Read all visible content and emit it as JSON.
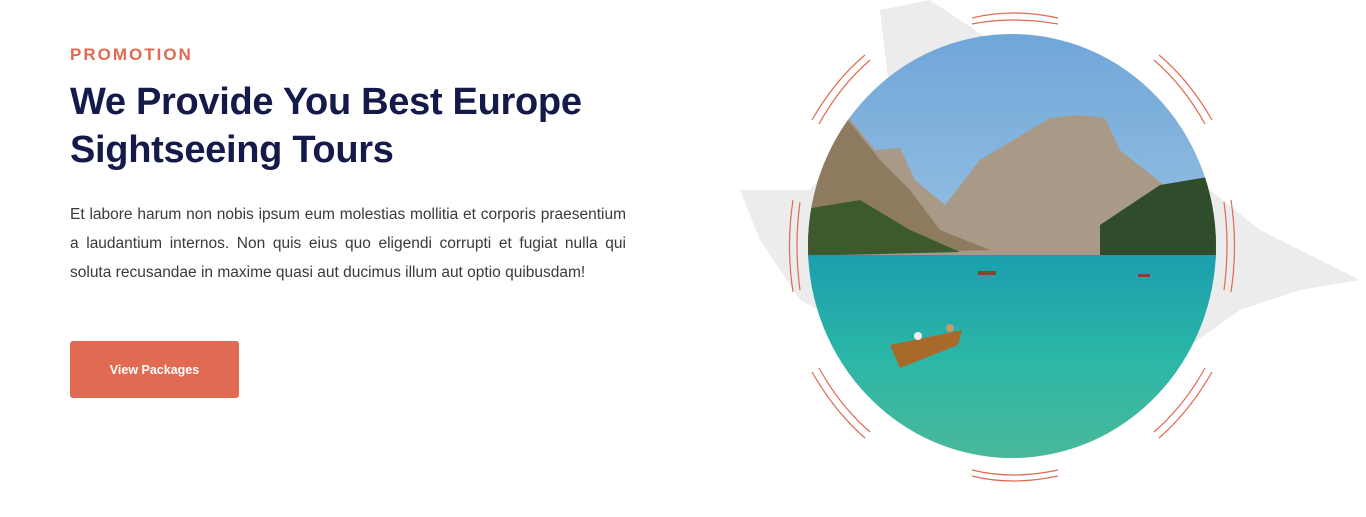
{
  "promo": {
    "eyebrow": "PROMOTION",
    "title": "We Provide You Best Europe Sightseeing Tours",
    "description": "Et labore harum non nobis ipsum eum molestias mollitia et corporis praesentium a laudantium internos. Non quis eius quo eligendi corrupti et fugiat nulla qui soluta recusandae in maxime quasi aut ducimus illum aut optio quibusdam!",
    "button_label": "View Packages"
  },
  "colors": {
    "accent": "#e06a52",
    "heading": "#141a4a"
  }
}
